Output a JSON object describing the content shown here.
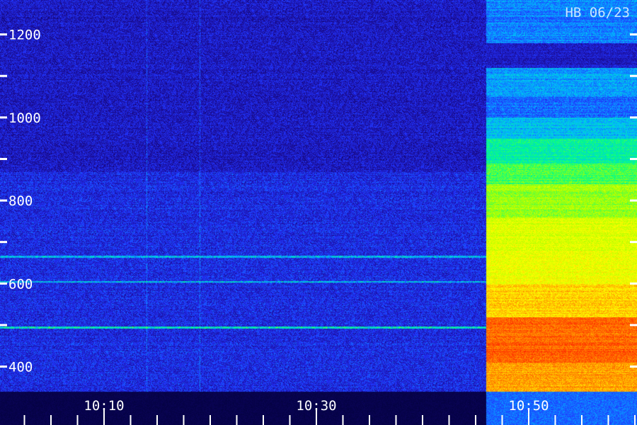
{
  "chart_data": {
    "type": "heatmap",
    "title": "",
    "xlabel": "",
    "ylabel": "",
    "annotation": "HB 06/23",
    "x_tick_labels": [
      "10:10",
      "10:30",
      "10:50"
    ],
    "x_labeled_ticks_minutes": [
      10,
      30,
      50
    ],
    "x_minor_tick_minutes": [
      0,
      2.5,
      5,
      7.5,
      10,
      12.5,
      15,
      17.5,
      20,
      22.5,
      25,
      27.5,
      30,
      32.5,
      35,
      37.5,
      40,
      42.5,
      45,
      47.5,
      50,
      52.5,
      55,
      57.5,
      60
    ],
    "xlim_time": [
      "10:00",
      "10:60"
    ],
    "y_tick_labels": [
      "1200",
      "1000",
      "800",
      "600",
      "400"
    ],
    "y_tick_values": [
      1200,
      1000,
      800,
      600,
      400
    ],
    "y_minor_tick_values": [
      1300,
      1200,
      1100,
      1000,
      900,
      800,
      700,
      600,
      500,
      400,
      300
    ],
    "ylim": [
      290,
      1300
    ],
    "grid": false,
    "colormap": [
      "#000033",
      "#1a0a8c",
      "#2233ff",
      "#00bbff",
      "#00ff88",
      "#aaff00",
      "#ffff00",
      "#ff8800",
      "#ff2200"
    ],
    "onset_time": "10:46",
    "persistent_lines_value": [
      665,
      605,
      495
    ],
    "persistent_lines_color": [
      "#33ddee",
      "#33ccdd",
      "#66ff66"
    ],
    "vertical_streaks_time": [
      "10:14",
      "10:19"
    ],
    "bright_bands": [
      {
        "from": 1300,
        "to": 1180,
        "level": 0.32
      },
      {
        "from": 1180,
        "to": 1120,
        "level": 0.18
      },
      {
        "from": 1120,
        "to": 1050,
        "level": 0.35
      },
      {
        "from": 1050,
        "to": 1000,
        "level": 0.3
      },
      {
        "from": 1000,
        "to": 950,
        "level": 0.38
      },
      {
        "from": 950,
        "to": 890,
        "level": 0.48
      },
      {
        "from": 890,
        "to": 840,
        "level": 0.55
      },
      {
        "from": 840,
        "to": 760,
        "level": 0.62
      },
      {
        "from": 760,
        "to": 680,
        "level": 0.7
      },
      {
        "from": 680,
        "to": 600,
        "level": 0.72
      },
      {
        "from": 600,
        "to": 520,
        "level": 0.8
      },
      {
        "from": 520,
        "to": 410,
        "level": 0.92
      },
      {
        "from": 410,
        "to": 330,
        "level": 0.85
      },
      {
        "from": 330,
        "to": 300,
        "level": 0.5
      },
      {
        "from": 300,
        "to": 290,
        "level": 0.3
      }
    ]
  }
}
